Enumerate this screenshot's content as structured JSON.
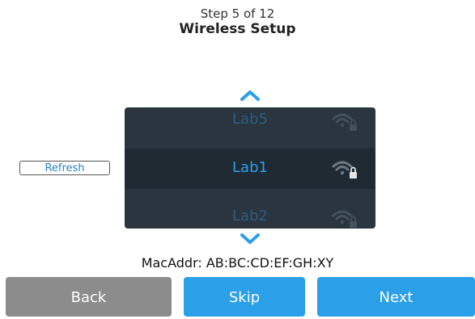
{
  "header": {
    "step": "Step 5 of 12",
    "title": "Wireless Setup"
  },
  "refresh_label": "Refresh",
  "networks": [
    {
      "name": "Lab5",
      "secured": true,
      "state": "dim"
    },
    {
      "name": "Lab1",
      "secured": true,
      "state": "selected"
    },
    {
      "name": "Lab2",
      "secured": true,
      "state": "dim"
    }
  ],
  "mac": "MacAddr: AB:BC:CD:EF:GH:XY",
  "buttons": {
    "back": "Back",
    "skip": "Skip",
    "next": "Next"
  },
  "colors": {
    "accent": "#2b9fe8",
    "picker_bg": "#2a353f",
    "back_button": "#8c8c8c"
  }
}
